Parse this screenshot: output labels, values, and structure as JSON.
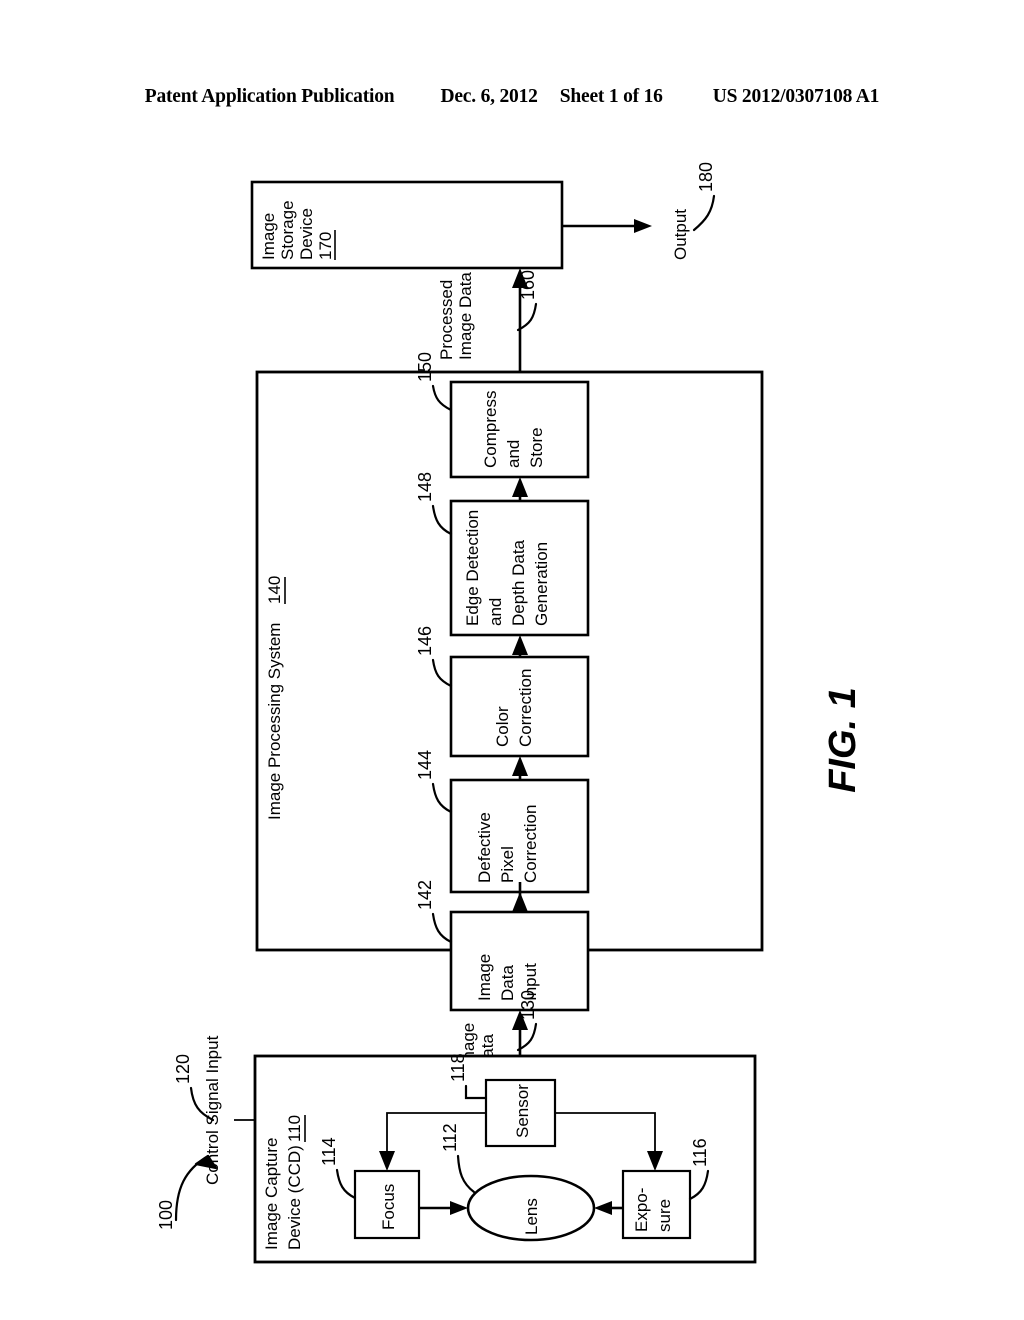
{
  "header": {
    "publication": "Patent Application Publication",
    "date": "Dec. 6, 2012",
    "sheet": "Sheet 1 of 16",
    "doc_number": "US 2012/0307108 A1"
  },
  "figure": {
    "label": "FIG. 1",
    "system_ref": "100"
  },
  "storage": {
    "line1": "Image",
    "line2": "Storage",
    "line3": "Device",
    "ref": "170"
  },
  "output": {
    "label": "Output",
    "ref": "180"
  },
  "processed_flow": {
    "line1": "Processed",
    "line2": "Image Data",
    "ref": "160"
  },
  "processing_system": {
    "label": "Image Processing System",
    "ref": "140",
    "blocks": [
      {
        "name": "image-data-input",
        "ref": "142",
        "lines": [
          "Image",
          "Data",
          "Input"
        ]
      },
      {
        "name": "defective-pixel-correction",
        "ref": "144",
        "lines": [
          "Defective",
          "Pixel",
          "Correction"
        ]
      },
      {
        "name": "color-correction",
        "ref": "146",
        "lines": [
          "Color",
          "Correction"
        ]
      },
      {
        "name": "edge-detection-depth-data-generation",
        "ref": "148",
        "lines": [
          "Edge Detection",
          "and",
          "Depth Data",
          "Generation"
        ]
      },
      {
        "name": "compress-and-store",
        "ref": "150",
        "lines": [
          "Compress",
          "and",
          "Store"
        ]
      }
    ]
  },
  "image_data_flow": {
    "line1": "Image",
    "line2": "Data",
    "ref": "130"
  },
  "control_signal": {
    "label": "Control Signal Input",
    "ref": "120"
  },
  "capture_device": {
    "line1": "Image Capture",
    "line2": "Device (CCD)",
    "ref": "110",
    "blocks": [
      {
        "name": "focus",
        "label": "Focus",
        "ref": "114"
      },
      {
        "name": "lens",
        "label": "Lens",
        "ref": "112"
      },
      {
        "name": "sensor",
        "label": "Sensor",
        "ref": "118"
      },
      {
        "name": "exposure",
        "label": "Expo-–sure",
        "ref": "116",
        "line1": "Expo-",
        "line2": "sure"
      }
    ]
  }
}
